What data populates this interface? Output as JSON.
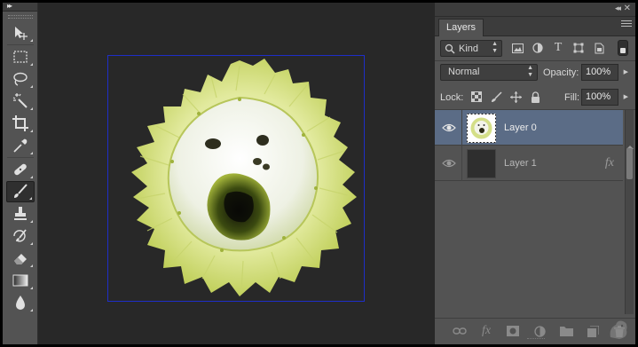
{
  "toolbar": {
    "tools": [
      {
        "name": "move-tool",
        "icon": "move-icon"
      },
      {
        "name": "marquee-tool",
        "icon": "rect-marquee-icon"
      },
      {
        "name": "lasso-tool",
        "icon": "lasso-icon"
      },
      {
        "name": "magic-wand-tool",
        "icon": "magic-wand-icon"
      },
      {
        "name": "crop-tool",
        "icon": "crop-icon"
      },
      {
        "name": "eyedropper-tool",
        "icon": "eyedropper-icon"
      },
      {
        "name": "healing-brush-tool",
        "icon": "bandage-icon"
      },
      {
        "name": "brush-tool",
        "icon": "brush-icon",
        "active": true
      },
      {
        "name": "clone-stamp-tool",
        "icon": "stamp-icon"
      },
      {
        "name": "history-brush-tool",
        "icon": "history-brush-icon"
      },
      {
        "name": "eraser-tool",
        "icon": "eraser-icon"
      },
      {
        "name": "gradient-tool",
        "icon": "gradient-icon"
      },
      {
        "name": "blur-tool",
        "icon": "drop-icon"
      }
    ]
  },
  "layers_panel": {
    "tab_label": "Layers",
    "filter": {
      "kind_label": "Kind"
    },
    "blend_mode": "Normal",
    "opacity_label": "Opacity:",
    "opacity_value": "100%",
    "lock_label": "Lock:",
    "fill_label": "Fill:",
    "fill_value": "100%",
    "layers": [
      {
        "name": "Layer 0",
        "selected": true,
        "visible": true
      },
      {
        "name": "Layer 1",
        "selected": false,
        "visible": true,
        "has_fx": true,
        "fx_label": "fx"
      }
    ],
    "bottom_icons": [
      "link-icon",
      "fx-icon",
      "mask-icon",
      "adjustment-icon",
      "folder-icon",
      "new-layer-icon",
      "trash-icon"
    ],
    "bottom_fx_label": "fx"
  },
  "colors": {
    "selected_layer": "#5b6c86",
    "bounding_box": "#1e2ec8",
    "panel_bg": "#535353",
    "canvas_bg": "#282828"
  }
}
